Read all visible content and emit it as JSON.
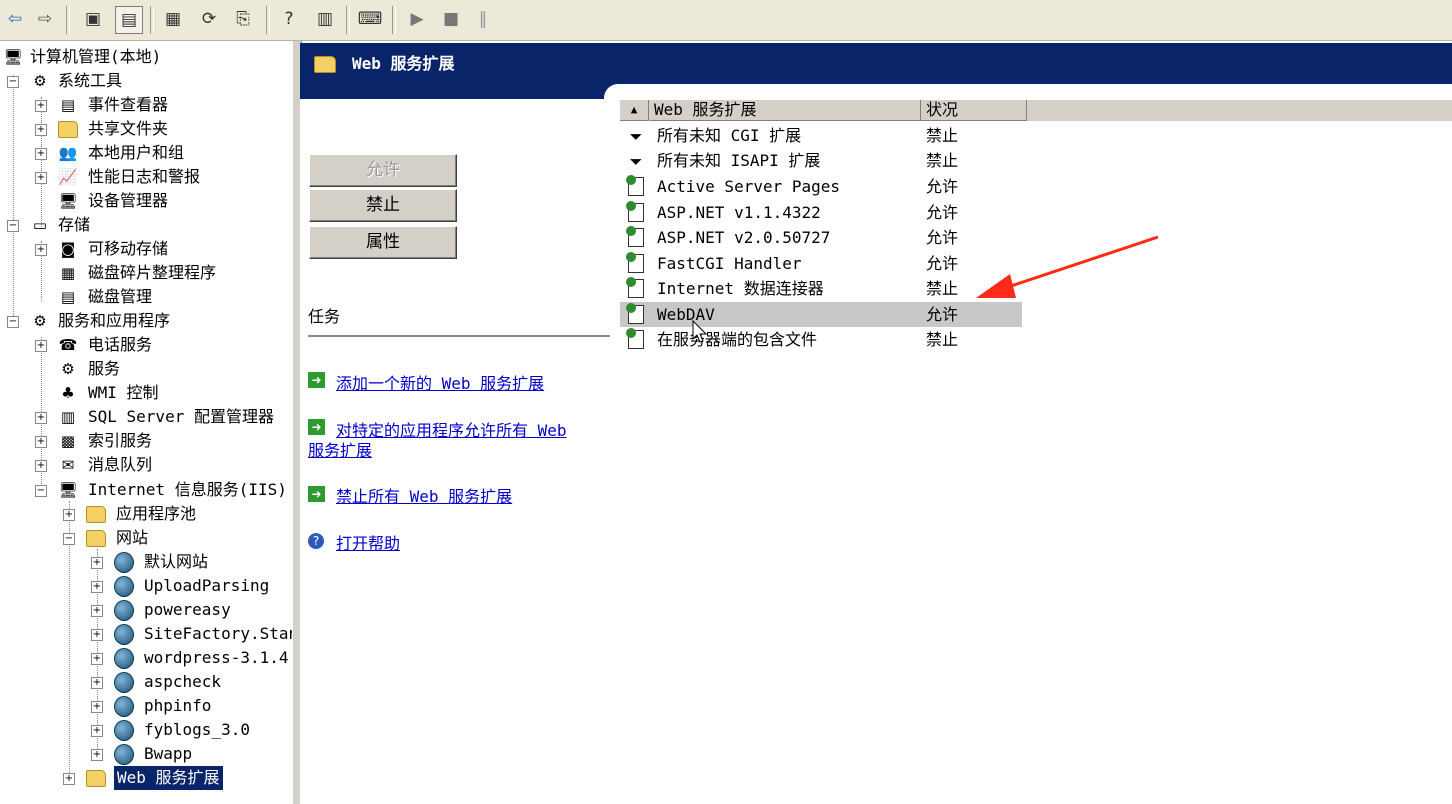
{
  "toolbar": {
    "buttons": [
      "back-icon",
      "forward-icon",
      "up-folder-icon",
      "show-tree-icon",
      "properties-icon",
      "refresh-icon",
      "export-icon",
      "help-icon",
      "console-icon",
      "computer-icon",
      "play-icon",
      "stop-icon",
      "pause-icon"
    ]
  },
  "tree": {
    "root": "计算机管理(本地)",
    "system_tools": "系统工具",
    "event_viewer": "事件查看器",
    "shared_folders": "共享文件夹",
    "local_users": "本地用户和组",
    "perf_logs": "性能日志和警报",
    "device_manager": "设备管理器",
    "storage": "存储",
    "removable_storage": "可移动存储",
    "defrag": "磁盘碎片整理程序",
    "disk_mgmt": "磁盘管理",
    "services_apps": "服务和应用程序",
    "telephony": "电话服务",
    "services": "服务",
    "wmi": "WMI 控制",
    "sql": "SQL Server 配置管理器",
    "indexing": "索引服务",
    "msmq": "消息队列",
    "iis": "Internet 信息服务(IIS)",
    "app_pools": "应用程序池",
    "websites": "网站",
    "sites": [
      "默认网站",
      "UploadParsing",
      "powereasy",
      "SiteFactory.Stan",
      "wordpress-3.1.4",
      "aspcheck",
      "phpinfo",
      "fyblogs_3.0",
      "Bwapp"
    ],
    "web_ext": "Web 服务扩展"
  },
  "header": {
    "title": "Web 服务扩展"
  },
  "buttons": {
    "allow": "允许",
    "prohibit": "禁止",
    "properties": "属性"
  },
  "tasks": {
    "label": "任务",
    "add_new": "添加一个新的 Web 服务扩展",
    "allow_all_1": "对特定的应用程序允许所有 Web",
    "allow_all_2": "服务扩展",
    "prohibit_all": "禁止所有 Web 服务扩展",
    "help": "打开帮助"
  },
  "list": {
    "col_name": "Web 服务扩展",
    "col_status": "状况",
    "rows": [
      {
        "name": "所有未知 CGI 扩展",
        "status": "禁止"
      },
      {
        "name": "所有未知 ISAPI 扩展",
        "status": "禁止"
      },
      {
        "name": "Active Server Pages",
        "status": "允许"
      },
      {
        "name": "ASP.NET v1.1.4322",
        "status": "允许"
      },
      {
        "name": "ASP.NET v2.0.50727",
        "status": "允许"
      },
      {
        "name": "FastCGI Handler",
        "status": "允许"
      },
      {
        "name": "Internet 数据连接器",
        "status": "禁止"
      },
      {
        "name": "WebDAV",
        "status": "允许"
      },
      {
        "name": "在服务器端的包含文件",
        "status": "禁止"
      }
    ]
  },
  "colors": {
    "header_bg": "#0a246a",
    "link": "#0000cc",
    "arrow": "#ff2a1a",
    "selected": "#0a246a"
  }
}
